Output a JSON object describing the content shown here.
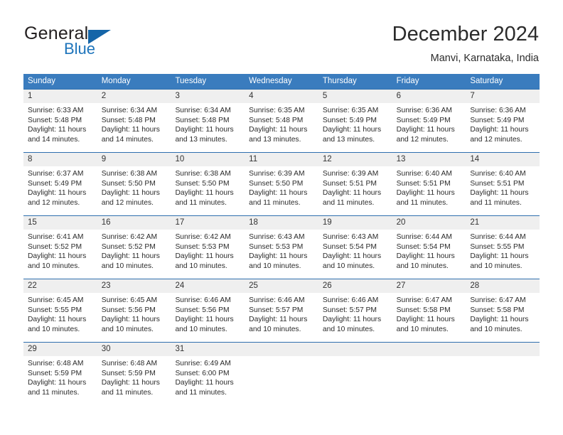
{
  "brand": {
    "word_one": "General",
    "word_two": "Blue",
    "flag_icon": "blue-triangle-flag-icon",
    "accent_color": "#1d74bb"
  },
  "header": {
    "month_title": "December 2024",
    "location": "Manvi, Karnataka, India"
  },
  "calendar": {
    "header_bg": "#3a7cbe",
    "datenum_bg": "#efefef",
    "separator_color": "#2f6fae",
    "weekdays": [
      "Sunday",
      "Monday",
      "Tuesday",
      "Wednesday",
      "Thursday",
      "Friday",
      "Saturday"
    ],
    "weeks": [
      {
        "days": [
          {
            "date": "1",
            "sunrise": "Sunrise: 6:33 AM",
            "sunset": "Sunset: 5:48 PM",
            "daylight_line1": "Daylight: 11 hours",
            "daylight_line2": "and 14 minutes."
          },
          {
            "date": "2",
            "sunrise": "Sunrise: 6:34 AM",
            "sunset": "Sunset: 5:48 PM",
            "daylight_line1": "Daylight: 11 hours",
            "daylight_line2": "and 14 minutes."
          },
          {
            "date": "3",
            "sunrise": "Sunrise: 6:34 AM",
            "sunset": "Sunset: 5:48 PM",
            "daylight_line1": "Daylight: 11 hours",
            "daylight_line2": "and 13 minutes."
          },
          {
            "date": "4",
            "sunrise": "Sunrise: 6:35 AM",
            "sunset": "Sunset: 5:48 PM",
            "daylight_line1": "Daylight: 11 hours",
            "daylight_line2": "and 13 minutes."
          },
          {
            "date": "5",
            "sunrise": "Sunrise: 6:35 AM",
            "sunset": "Sunset: 5:49 PM",
            "daylight_line1": "Daylight: 11 hours",
            "daylight_line2": "and 13 minutes."
          },
          {
            "date": "6",
            "sunrise": "Sunrise: 6:36 AM",
            "sunset": "Sunset: 5:49 PM",
            "daylight_line1": "Daylight: 11 hours",
            "daylight_line2": "and 12 minutes."
          },
          {
            "date": "7",
            "sunrise": "Sunrise: 6:36 AM",
            "sunset": "Sunset: 5:49 PM",
            "daylight_line1": "Daylight: 11 hours",
            "daylight_line2": "and 12 minutes."
          }
        ]
      },
      {
        "days": [
          {
            "date": "8",
            "sunrise": "Sunrise: 6:37 AM",
            "sunset": "Sunset: 5:49 PM",
            "daylight_line1": "Daylight: 11 hours",
            "daylight_line2": "and 12 minutes."
          },
          {
            "date": "9",
            "sunrise": "Sunrise: 6:38 AM",
            "sunset": "Sunset: 5:50 PM",
            "daylight_line1": "Daylight: 11 hours",
            "daylight_line2": "and 12 minutes."
          },
          {
            "date": "10",
            "sunrise": "Sunrise: 6:38 AM",
            "sunset": "Sunset: 5:50 PM",
            "daylight_line1": "Daylight: 11 hours",
            "daylight_line2": "and 11 minutes."
          },
          {
            "date": "11",
            "sunrise": "Sunrise: 6:39 AM",
            "sunset": "Sunset: 5:50 PM",
            "daylight_line1": "Daylight: 11 hours",
            "daylight_line2": "and 11 minutes."
          },
          {
            "date": "12",
            "sunrise": "Sunrise: 6:39 AM",
            "sunset": "Sunset: 5:51 PM",
            "daylight_line1": "Daylight: 11 hours",
            "daylight_line2": "and 11 minutes."
          },
          {
            "date": "13",
            "sunrise": "Sunrise: 6:40 AM",
            "sunset": "Sunset: 5:51 PM",
            "daylight_line1": "Daylight: 11 hours",
            "daylight_line2": "and 11 minutes."
          },
          {
            "date": "14",
            "sunrise": "Sunrise: 6:40 AM",
            "sunset": "Sunset: 5:51 PM",
            "daylight_line1": "Daylight: 11 hours",
            "daylight_line2": "and 11 minutes."
          }
        ]
      },
      {
        "days": [
          {
            "date": "15",
            "sunrise": "Sunrise: 6:41 AM",
            "sunset": "Sunset: 5:52 PM",
            "daylight_line1": "Daylight: 11 hours",
            "daylight_line2": "and 10 minutes."
          },
          {
            "date": "16",
            "sunrise": "Sunrise: 6:42 AM",
            "sunset": "Sunset: 5:52 PM",
            "daylight_line1": "Daylight: 11 hours",
            "daylight_line2": "and 10 minutes."
          },
          {
            "date": "17",
            "sunrise": "Sunrise: 6:42 AM",
            "sunset": "Sunset: 5:53 PM",
            "daylight_line1": "Daylight: 11 hours",
            "daylight_line2": "and 10 minutes."
          },
          {
            "date": "18",
            "sunrise": "Sunrise: 6:43 AM",
            "sunset": "Sunset: 5:53 PM",
            "daylight_line1": "Daylight: 11 hours",
            "daylight_line2": "and 10 minutes."
          },
          {
            "date": "19",
            "sunrise": "Sunrise: 6:43 AM",
            "sunset": "Sunset: 5:54 PM",
            "daylight_line1": "Daylight: 11 hours",
            "daylight_line2": "and 10 minutes."
          },
          {
            "date": "20",
            "sunrise": "Sunrise: 6:44 AM",
            "sunset": "Sunset: 5:54 PM",
            "daylight_line1": "Daylight: 11 hours",
            "daylight_line2": "and 10 minutes."
          },
          {
            "date": "21",
            "sunrise": "Sunrise: 6:44 AM",
            "sunset": "Sunset: 5:55 PM",
            "daylight_line1": "Daylight: 11 hours",
            "daylight_line2": "and 10 minutes."
          }
        ]
      },
      {
        "days": [
          {
            "date": "22",
            "sunrise": "Sunrise: 6:45 AM",
            "sunset": "Sunset: 5:55 PM",
            "daylight_line1": "Daylight: 11 hours",
            "daylight_line2": "and 10 minutes."
          },
          {
            "date": "23",
            "sunrise": "Sunrise: 6:45 AM",
            "sunset": "Sunset: 5:56 PM",
            "daylight_line1": "Daylight: 11 hours",
            "daylight_line2": "and 10 minutes."
          },
          {
            "date": "24",
            "sunrise": "Sunrise: 6:46 AM",
            "sunset": "Sunset: 5:56 PM",
            "daylight_line1": "Daylight: 11 hours",
            "daylight_line2": "and 10 minutes."
          },
          {
            "date": "25",
            "sunrise": "Sunrise: 6:46 AM",
            "sunset": "Sunset: 5:57 PM",
            "daylight_line1": "Daylight: 11 hours",
            "daylight_line2": "and 10 minutes."
          },
          {
            "date": "26",
            "sunrise": "Sunrise: 6:46 AM",
            "sunset": "Sunset: 5:57 PM",
            "daylight_line1": "Daylight: 11 hours",
            "daylight_line2": "and 10 minutes."
          },
          {
            "date": "27",
            "sunrise": "Sunrise: 6:47 AM",
            "sunset": "Sunset: 5:58 PM",
            "daylight_line1": "Daylight: 11 hours",
            "daylight_line2": "and 10 minutes."
          },
          {
            "date": "28",
            "sunrise": "Sunrise: 6:47 AM",
            "sunset": "Sunset: 5:58 PM",
            "daylight_line1": "Daylight: 11 hours",
            "daylight_line2": "and 10 minutes."
          }
        ]
      },
      {
        "days": [
          {
            "date": "29",
            "sunrise": "Sunrise: 6:48 AM",
            "sunset": "Sunset: 5:59 PM",
            "daylight_line1": "Daylight: 11 hours",
            "daylight_line2": "and 11 minutes."
          },
          {
            "date": "30",
            "sunrise": "Sunrise: 6:48 AM",
            "sunset": "Sunset: 5:59 PM",
            "daylight_line1": "Daylight: 11 hours",
            "daylight_line2": "and 11 minutes."
          },
          {
            "date": "31",
            "sunrise": "Sunrise: 6:49 AM",
            "sunset": "Sunset: 6:00 PM",
            "daylight_line1": "Daylight: 11 hours",
            "daylight_line2": "and 11 minutes."
          },
          {
            "date": "",
            "sunrise": "",
            "sunset": "",
            "daylight_line1": "",
            "daylight_line2": ""
          },
          {
            "date": "",
            "sunrise": "",
            "sunset": "",
            "daylight_line1": "",
            "daylight_line2": ""
          },
          {
            "date": "",
            "sunrise": "",
            "sunset": "",
            "daylight_line1": "",
            "daylight_line2": ""
          },
          {
            "date": "",
            "sunrise": "",
            "sunset": "",
            "daylight_line1": "",
            "daylight_line2": ""
          }
        ]
      }
    ]
  }
}
